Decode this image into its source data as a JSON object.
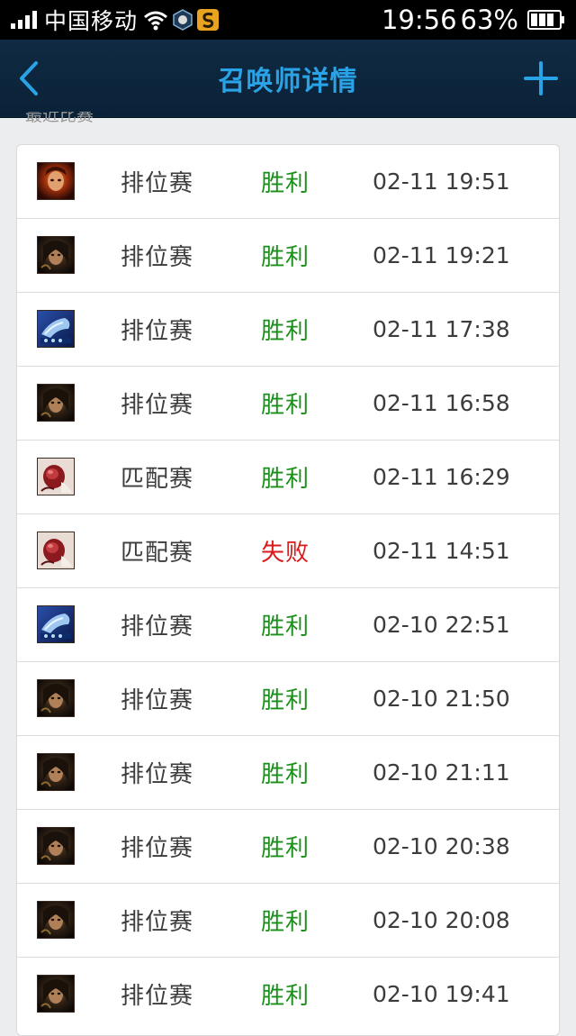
{
  "status_bar": {
    "carrier": "中国移动",
    "time": "19:56",
    "battery": "63%"
  },
  "header": {
    "title": "召唤师详情",
    "back_icon": "chevron-left-icon",
    "add_icon": "plus-icon"
  },
  "section": {
    "label": "最近比赛"
  },
  "colors": {
    "win": "#1a8f1a",
    "loss": "#d91a1a",
    "title": "#2aa3e6"
  },
  "matches": [
    {
      "champion_icon": "champion-portrait-fiery",
      "mode": "排位赛",
      "result": "胜利",
      "outcome": "win",
      "time": "02-11 19:51"
    },
    {
      "champion_icon": "champion-portrait-dark",
      "mode": "排位赛",
      "result": "胜利",
      "outcome": "win",
      "time": "02-11 19:21"
    },
    {
      "champion_icon": "champion-portrait-blue",
      "mode": "排位赛",
      "result": "胜利",
      "outcome": "win",
      "time": "02-11 17:38"
    },
    {
      "champion_icon": "champion-portrait-dark",
      "mode": "排位赛",
      "result": "胜利",
      "outcome": "win",
      "time": "02-11 16:58"
    },
    {
      "champion_icon": "champion-portrait-red",
      "mode": "匹配赛",
      "result": "胜利",
      "outcome": "win",
      "time": "02-11 16:29"
    },
    {
      "champion_icon": "champion-portrait-red",
      "mode": "匹配赛",
      "result": "失败",
      "outcome": "loss",
      "time": "02-11 14:51"
    },
    {
      "champion_icon": "champion-portrait-blue",
      "mode": "排位赛",
      "result": "胜利",
      "outcome": "win",
      "time": "02-10 22:51"
    },
    {
      "champion_icon": "champion-portrait-dark",
      "mode": "排位赛",
      "result": "胜利",
      "outcome": "win",
      "time": "02-10 21:50"
    },
    {
      "champion_icon": "champion-portrait-dark",
      "mode": "排位赛",
      "result": "胜利",
      "outcome": "win",
      "time": "02-10 21:11"
    },
    {
      "champion_icon": "champion-portrait-dark",
      "mode": "排位赛",
      "result": "胜利",
      "outcome": "win",
      "time": "02-10 20:38"
    },
    {
      "champion_icon": "champion-portrait-dark",
      "mode": "排位赛",
      "result": "胜利",
      "outcome": "win",
      "time": "02-10 20:08"
    },
    {
      "champion_icon": "champion-portrait-dark",
      "mode": "排位赛",
      "result": "胜利",
      "outcome": "win",
      "time": "02-10 19:41"
    }
  ]
}
